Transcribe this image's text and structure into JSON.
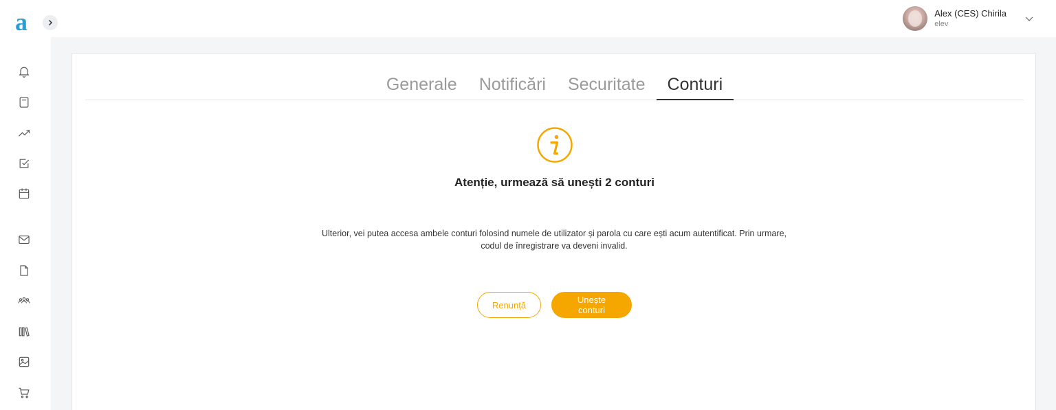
{
  "brand": {
    "logo_text": "a",
    "color": "#2a9fd6"
  },
  "sidebar": {
    "items": [
      {
        "icon": "bell-icon"
      },
      {
        "icon": "notebook-icon"
      },
      {
        "icon": "trending-up-icon"
      },
      {
        "icon": "checkbox-icon"
      },
      {
        "icon": "calendar-icon"
      },
      {
        "icon": "mail-icon"
      },
      {
        "icon": "file-icon"
      },
      {
        "icon": "users-icon"
      },
      {
        "icon": "library-icon"
      },
      {
        "icon": "image-icon"
      },
      {
        "icon": "cart-icon"
      }
    ]
  },
  "header": {
    "user_name": "Alex (CES) Chirila",
    "user_role": "elev"
  },
  "tabs": [
    {
      "label": "Generale"
    },
    {
      "label": "Notificări"
    },
    {
      "label": "Securitate"
    },
    {
      "label": "Conturi",
      "active": true
    }
  ],
  "dialog": {
    "title": "Atenție, urmează să unești 2 conturi",
    "description": "Ulterior, vei putea accesa ambele conturi folosind numele de utilizator și parola cu care ești acum autentificat. Prin urmare, codul de înregistrare va deveni invalid.",
    "cancel_label": "Renunță",
    "merge_label": "Unește conturi",
    "accent_color": "#f5a700"
  }
}
